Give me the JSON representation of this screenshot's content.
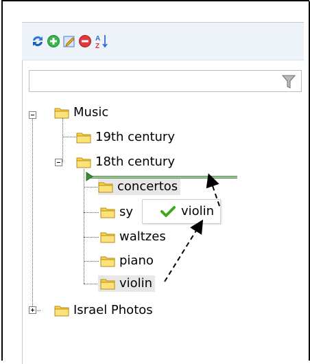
{
  "toolbar": {
    "buttons": [
      {
        "name": "refresh-button",
        "icon": "refresh-icon"
      },
      {
        "name": "add-button",
        "icon": "plus-circle-icon"
      },
      {
        "name": "edit-button",
        "icon": "edit-pencil-icon"
      },
      {
        "name": "delete-button",
        "icon": "minus-circle-icon"
      },
      {
        "name": "sort-button",
        "icon": "sort-az-icon",
        "text_top": "A",
        "text_bottom": "Z"
      }
    ]
  },
  "filter": {
    "value": "",
    "placeholder": "",
    "icon": "filter-funnel-icon"
  },
  "tree": {
    "nodes": [
      {
        "label": "Music",
        "expanded": true
      },
      {
        "label": "19th century"
      },
      {
        "label": "18th century",
        "expanded": true
      },
      {
        "label": "concertos"
      },
      {
        "label": "sy"
      },
      {
        "label": "waltzes"
      },
      {
        "label": "piano"
      },
      {
        "label": "violin",
        "state": "being dragged"
      },
      {
        "label": "Israel Photos",
        "expanded": false
      }
    ]
  },
  "drag": {
    "proxy_label": "violin",
    "status_icon": "checkmark-icon",
    "drop_indicator_icon": "drop-arrow-icon"
  },
  "colors": {
    "toolbar_bg": "#eef3fa",
    "folder_fill": "#f7d24a",
    "drop_line": "#9fc59a",
    "check_green": "#3ea81a",
    "hover_bg": "#e7e7e7"
  }
}
